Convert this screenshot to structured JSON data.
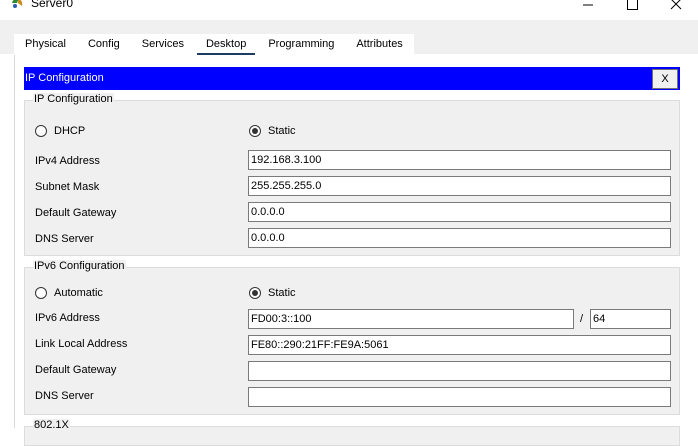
{
  "window": {
    "title": "Server0"
  },
  "tabs": [
    {
      "label": "Physical"
    },
    {
      "label": "Config"
    },
    {
      "label": "Services"
    },
    {
      "label": "Desktop",
      "active": true
    },
    {
      "label": "Programming"
    },
    {
      "label": "Attributes"
    }
  ],
  "dialog": {
    "title": "IP Configuration",
    "close_label": "X"
  },
  "ipv4": {
    "group_title": "IP Configuration",
    "dhcp_label": "DHCP",
    "static_label": "Static",
    "mode": "Static",
    "address_label": "IPv4 Address",
    "address": "192.168.3.100",
    "mask_label": "Subnet Mask",
    "mask": "255.255.255.0",
    "gateway_label": "Default Gateway",
    "gateway": "0.0.0.0",
    "dns_label": "DNS Server",
    "dns": "0.0.0.0"
  },
  "ipv6": {
    "group_title": "IPv6 Configuration",
    "auto_label": "Automatic",
    "static_label": "Static",
    "mode": "Static",
    "address_label": "IPv6 Address",
    "address": "FD00:3::100",
    "prefix_sep": "/",
    "prefix": "64",
    "link_local_label": "Link Local Address",
    "link_local": "FE80::290:21FF:FE9A:5061",
    "gateway_label": "Default Gateway",
    "gateway": "",
    "dns_label": "DNS Server",
    "dns": ""
  },
  "dot1x": {
    "group_title": "802.1X"
  },
  "colors": {
    "header_bg": "#0000ff",
    "active_tab_underline": "#1f3a63",
    "group_bg": "#f0f0f0"
  }
}
